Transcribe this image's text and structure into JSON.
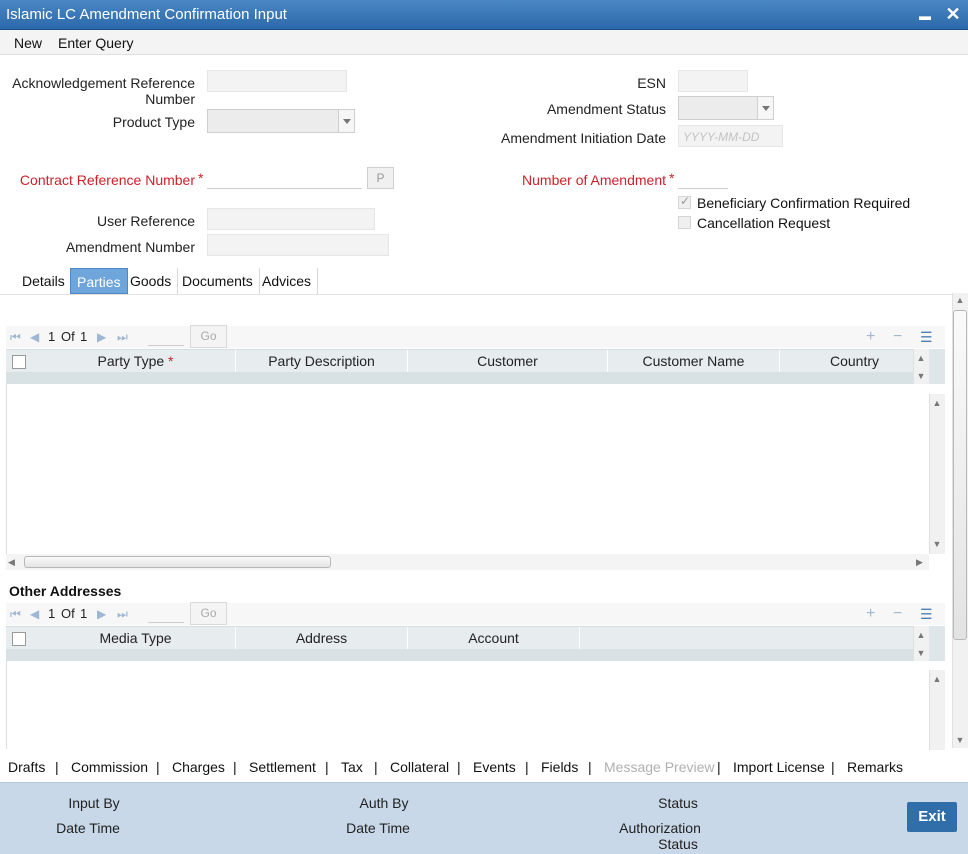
{
  "window": {
    "title": "Islamic LC Amendment Confirmation Input",
    "minimize": "▬",
    "close": "✕"
  },
  "menu": {
    "new": "New",
    "enter_query": "Enter Query"
  },
  "form": {
    "ack_ref_label_1": "Acknowledgement Reference",
    "ack_ref_label_2": "Number",
    "product_type_label": "Product Type",
    "contract_ref_label": "Contract Reference Number",
    "p_button": "P",
    "user_ref_label": "User Reference",
    "amendment_number_label": "Amendment Number",
    "esn_label": "ESN",
    "amendment_status_label": "Amendment Status",
    "amendment_init_date_label": "Amendment Initiation Date",
    "amendment_init_date_placeholder": "YYYY-MM-DD",
    "number_of_amendment_label": "Number of Amendment",
    "required_star": "*",
    "beneficiary_confirmation_label": "Beneficiary Confirmation Required",
    "beneficiary_confirmation_checked": true,
    "cancellation_request_label": "Cancellation Request",
    "cancellation_request_checked": false
  },
  "tabs": [
    "Details",
    "Parties",
    "Goods",
    "Documents",
    "Advices"
  ],
  "active_tab": "Parties",
  "parties_grid": {
    "page_current": "1",
    "page_of": "Of",
    "page_total": "1",
    "go": "Go",
    "columns": [
      "Party Type",
      "Party Description",
      "Customer",
      "Customer Name",
      "Country"
    ]
  },
  "other_addresses": {
    "title": "Other Addresses",
    "page_current": "1",
    "page_of": "Of",
    "page_total": "1",
    "go": "Go",
    "columns": [
      "Media Type",
      "Address",
      "Account"
    ]
  },
  "bottom_links": [
    "Drafts",
    "Commission",
    "Charges",
    "Settlement",
    "Tax",
    "Collateral",
    "Events",
    "Fields",
    "Message Preview",
    "Import License",
    "Remarks"
  ],
  "footer": {
    "input_by": "Input By",
    "date_time_1": "Date Time",
    "auth_by": "Auth By",
    "date_time_2": "Date Time",
    "status": "Status",
    "authorization": "Authorization",
    "authorization_status": "Status",
    "exit": "Exit"
  },
  "colors": {
    "title_bar": "#2d6aab",
    "active_tab": "#6ea6dc",
    "required": "#d0202a",
    "footer": "#c8d8e8",
    "exit_button": "#2f6ea8"
  }
}
